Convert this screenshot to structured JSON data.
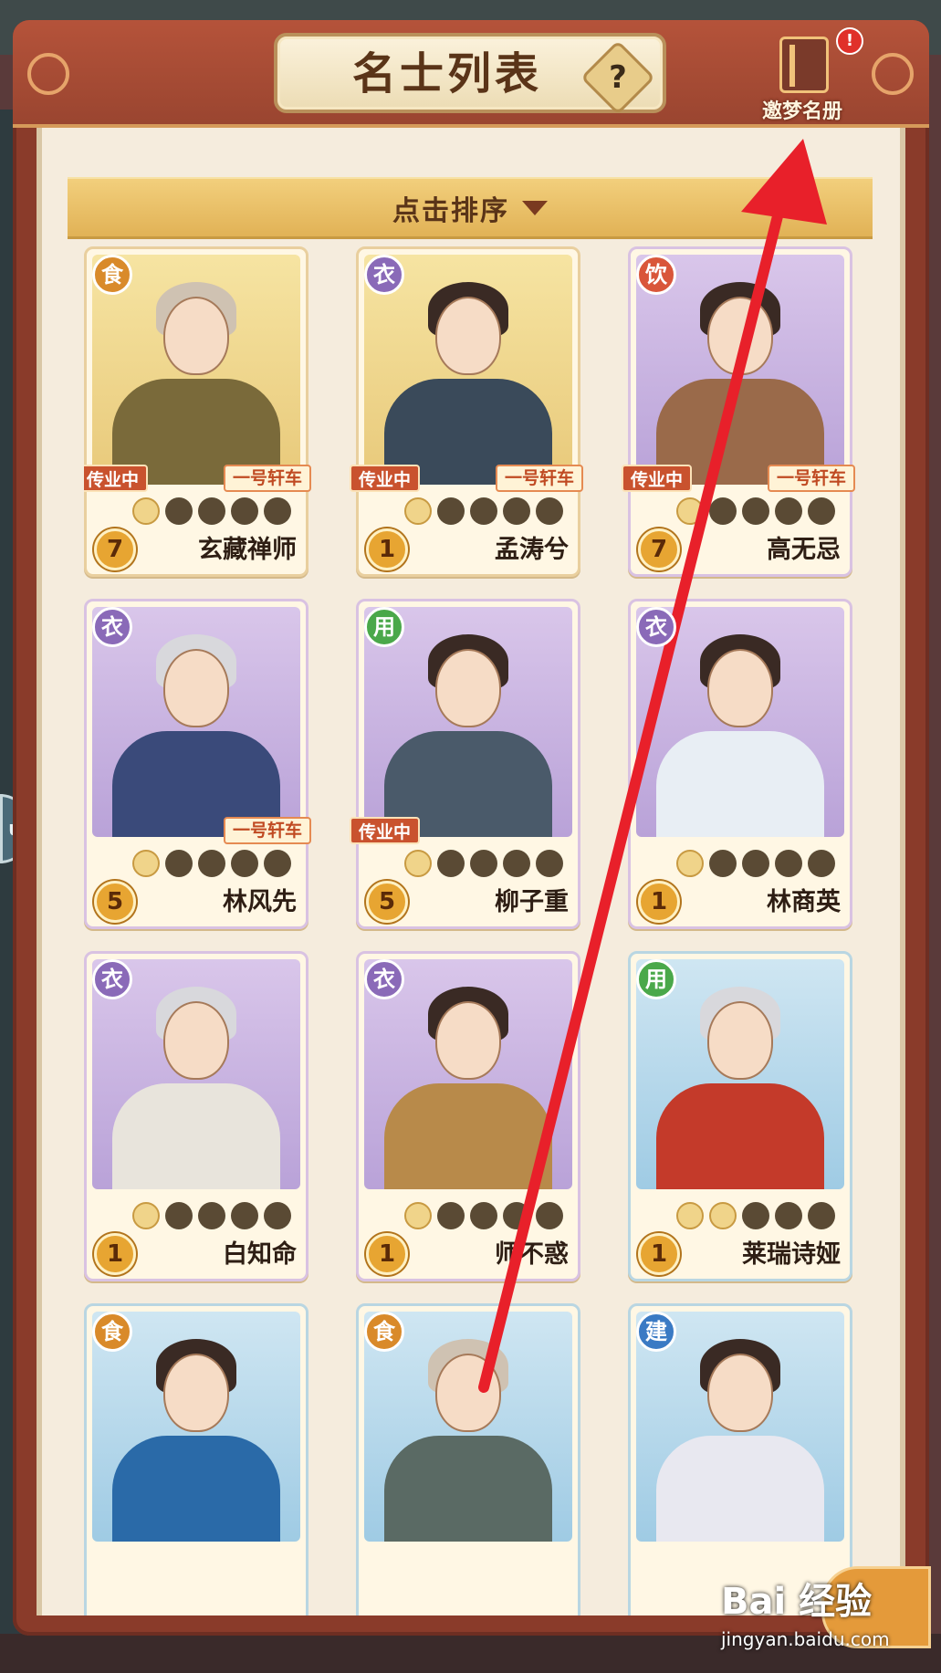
{
  "header": {
    "title": "名士列表",
    "help_label": "?",
    "roster_label": "邀梦名册",
    "alert_label": "!"
  },
  "left_tab": {
    "label": "u"
  },
  "sort": {
    "label": "点击排序"
  },
  "type_colors": {
    "食": "#d98a2a",
    "衣": "#8a6ab8",
    "饮": "#d9563a",
    "用": "#4aa84a",
    "建": "#3a7ac4"
  },
  "cards": [
    {
      "type": "食",
      "name": "玄藏禅师",
      "level": "7",
      "teaching": "传业中",
      "carriage": "一号轩车",
      "stars_lit": 1,
      "bg": "yellow"
    },
    {
      "type": "衣",
      "name": "孟涛兮",
      "level": "1",
      "teaching": "传业中",
      "carriage": "一号轩车",
      "stars_lit": 1,
      "bg": "yellow"
    },
    {
      "type": "饮",
      "name": "高无忌",
      "level": "7",
      "teaching": "传业中",
      "carriage": "一号轩车",
      "stars_lit": 1,
      "bg": "purple"
    },
    {
      "type": "衣",
      "name": "林风先",
      "level": "5",
      "teaching": "",
      "carriage": "一号轩车",
      "stars_lit": 1,
      "bg": "purple"
    },
    {
      "type": "用",
      "name": "柳子重",
      "level": "5",
      "teaching": "传业中",
      "carriage": "",
      "stars_lit": 1,
      "bg": "purple"
    },
    {
      "type": "衣",
      "name": "林商英",
      "level": "1",
      "teaching": "",
      "carriage": "",
      "stars_lit": 1,
      "bg": "purple"
    },
    {
      "type": "衣",
      "name": "白知命",
      "level": "1",
      "teaching": "",
      "carriage": "",
      "stars_lit": 1,
      "bg": "purple"
    },
    {
      "type": "衣",
      "name": "师不惑",
      "level": "1",
      "teaching": "",
      "carriage": "",
      "stars_lit": 1,
      "bg": "purple"
    },
    {
      "type": "用",
      "name": "莱瑞诗娅",
      "level": "1",
      "teaching": "",
      "carriage": "",
      "stars_lit": 2,
      "bg": "blue"
    },
    {
      "type": "食",
      "name": "",
      "level": "",
      "teaching": "",
      "carriage": "",
      "stars_lit": 0,
      "bg": "blue"
    },
    {
      "type": "食",
      "name": "",
      "level": "",
      "teaching": "",
      "carriage": "",
      "stars_lit": 0,
      "bg": "blue"
    },
    {
      "type": "建",
      "name": "",
      "level": "",
      "teaching": "",
      "carriage": "",
      "stars_lit": 0,
      "bg": "blue"
    }
  ],
  "watermark": {
    "brand": "Bai 经验",
    "url": "jingyan.baidu.com"
  }
}
